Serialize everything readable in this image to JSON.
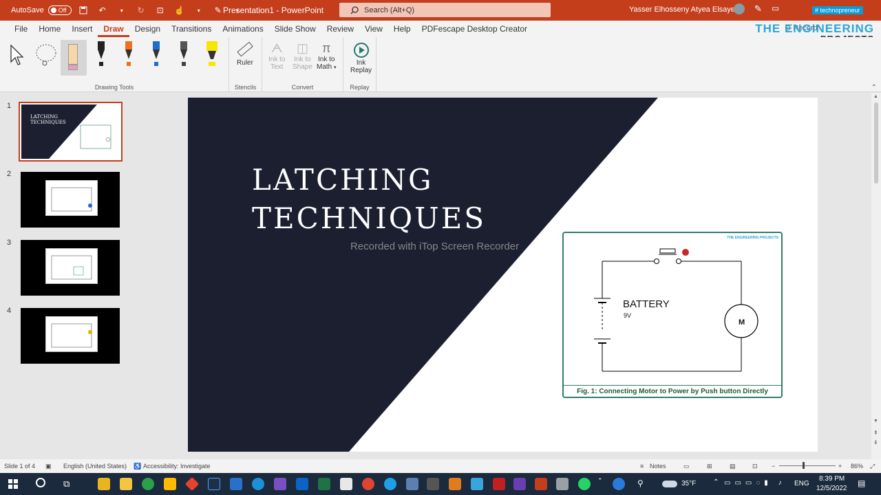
{
  "titlebar": {
    "autosave_label": "AutoSave",
    "autosave_state": "Off",
    "doc_title": "Presentation1 - PowerPoint",
    "search_placeholder": "Search (Alt+Q)",
    "user_name": "Yasser Elhosseny Atyea Elsayed",
    "tag": "# technopreneur",
    "accent": "#c43e1c"
  },
  "menu": {
    "tabs": [
      "File",
      "Home",
      "Insert",
      "Draw",
      "Design",
      "Transitions",
      "Animations",
      "Slide Show",
      "Review",
      "View",
      "Help",
      "PDFescape Desktop Creator"
    ],
    "active": "Draw",
    "record": "Record",
    "share": "Share",
    "brand_line1": "THE ENGINEERING",
    "brand_line2": "PROJECTS"
  },
  "ribbon": {
    "drawing_tools_label": "Drawing Tools",
    "stencils_label": "Stencils",
    "convert_label": "Convert",
    "replay_label": "Replay",
    "ruler": "Ruler",
    "ink_to_text_1": "Ink to",
    "ink_to_text_2": "Text",
    "ink_to_shape_1": "Ink to",
    "ink_to_shape_2": "Shape",
    "ink_to_math_1": "Ink to",
    "ink_to_math_2": "Math",
    "ink_replay_1": "Ink",
    "ink_replay_2": "Replay"
  },
  "thumbnails": {
    "numbers": [
      "1",
      "2",
      "3",
      "4"
    ],
    "slide1_title_line1": "LATCHING",
    "slide1_title_line2": "TECHNIQUES"
  },
  "slide": {
    "title_line1": "LATCHING",
    "title_line2": "TECHNIQUES",
    "watermark": "Recorded with iTop Screen Recorder",
    "battery_label": "BATTERY",
    "battery_voltage": "9V",
    "motor_label": "M",
    "caption": "Fig. 1: Connecting Motor to Power by Push button Directly",
    "fig_logo": "THE ENGINEERING PROJECTS",
    "dark_color": "#1b1f30"
  },
  "status": {
    "slide_info": "Slide 1 of 4",
    "language": "English (United States)",
    "accessibility": "Accessibility: Investigate",
    "notes": "Notes",
    "zoom": "86%"
  },
  "taskbar": {
    "temperature": "35°F",
    "lang": "ENG",
    "time": "8:39 PM",
    "date": "12/5/2022"
  }
}
